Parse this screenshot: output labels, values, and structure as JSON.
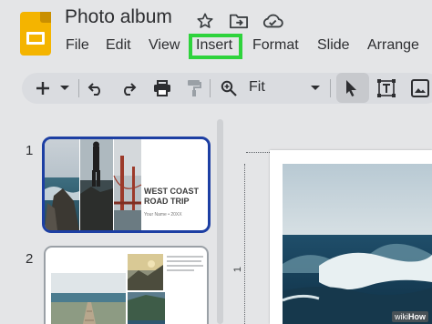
{
  "header": {
    "doc_title": "Photo album",
    "icons": [
      "star-icon",
      "move-to-folder-icon",
      "cloud-saved-icon"
    ]
  },
  "menu": {
    "items": [
      "File",
      "Edit",
      "View",
      "Insert",
      "Format",
      "Slide",
      "Arrange"
    ],
    "highlighted": "Insert",
    "highlight_color": "#2ed33c"
  },
  "toolbar": {
    "zoom_label": "Fit",
    "icons": [
      "new-slide-plus-icon",
      "new-slide-dropdown-icon",
      "undo-icon",
      "redo-icon",
      "print-icon",
      "paint-format-icon",
      "zoom-icon",
      "zoom-dropdown-icon",
      "select-cursor-icon",
      "text-box-icon",
      "image-icon"
    ]
  },
  "filmstrip": {
    "slides": [
      {
        "number": "1",
        "title": "WEST COAST ROAD TRIP",
        "subtitle": "Your Name • 20XX",
        "selected": true
      },
      {
        "number": "2",
        "caption": "Lorem ipsum dolor sit amet"
      }
    ]
  },
  "editor": {
    "ruler_number": "1"
  },
  "watermark": {
    "wiki": "wiki",
    "how": "How"
  },
  "colors": {
    "accent_blue": "#1d3fa3",
    "app_yellow": "#f4b400",
    "background": "#e4e5e7"
  }
}
